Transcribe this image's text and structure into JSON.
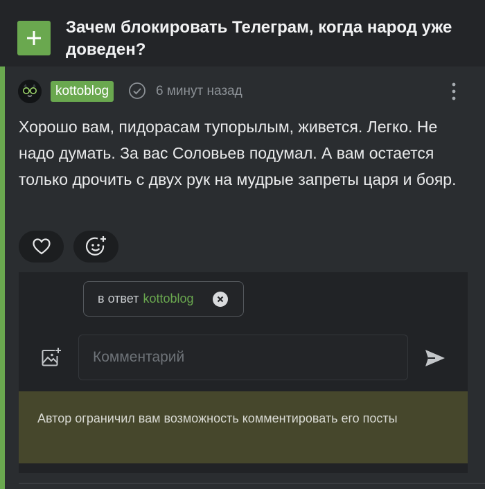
{
  "post": {
    "title": "Зачем блокировать Телеграм, когда народ уже доведен?"
  },
  "comment": {
    "username": "kottoblog",
    "time": "6 минут назад",
    "text": "Хорошо вам, пидорасам тупорылым, живется. Легко. Не надо думать. За вас Соловьев подумал. А вам остается только дрочить с двух рук на мудрые запреты царя и бояр."
  },
  "reply": {
    "prefix": "в ответ",
    "user": "kottoblog",
    "placeholder": "Комментарий"
  },
  "notice": {
    "text": "Автор ограничил вам возможность комментировать его посты"
  },
  "colors": {
    "accent": "#6aa84f",
    "background": "#232528",
    "notice_bg": "#46472c"
  },
  "icons": [
    "plus-icon",
    "verified-icon",
    "more-vertical-icon",
    "heart-icon",
    "emoji-add-icon",
    "close-icon",
    "image-add-icon",
    "send-icon"
  ]
}
